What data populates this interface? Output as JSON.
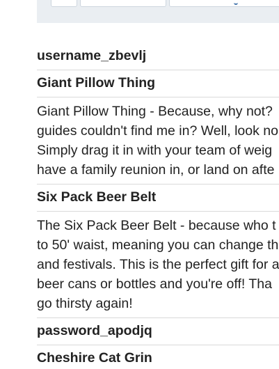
{
  "toolbar": {
    "buttons": [
      "",
      "",
      ""
    ]
  },
  "items": [
    {
      "title": "username_zbevlj"
    },
    {
      "title": "Giant Pillow Thing",
      "desc_lines": [
        "Giant Pillow Thing - Because, why not?",
        "guides couldn't find me in? Well, look no",
        "Simply drag it in with your team of weig",
        "have a family reunion in, or land on afte"
      ]
    },
    {
      "title": "Six Pack Beer Belt",
      "desc_lines": [
        "The Six Pack Beer Belt - because who t",
        "to 50' waist, meaning you can change th",
        "and festivals. This is the perfect gift for a",
        "beer cans or bottles and you're off! Tha",
        "go thirsty again!"
      ]
    },
    {
      "title": "password_apodjq"
    },
    {
      "title": "Cheshire Cat Grin"
    }
  ]
}
